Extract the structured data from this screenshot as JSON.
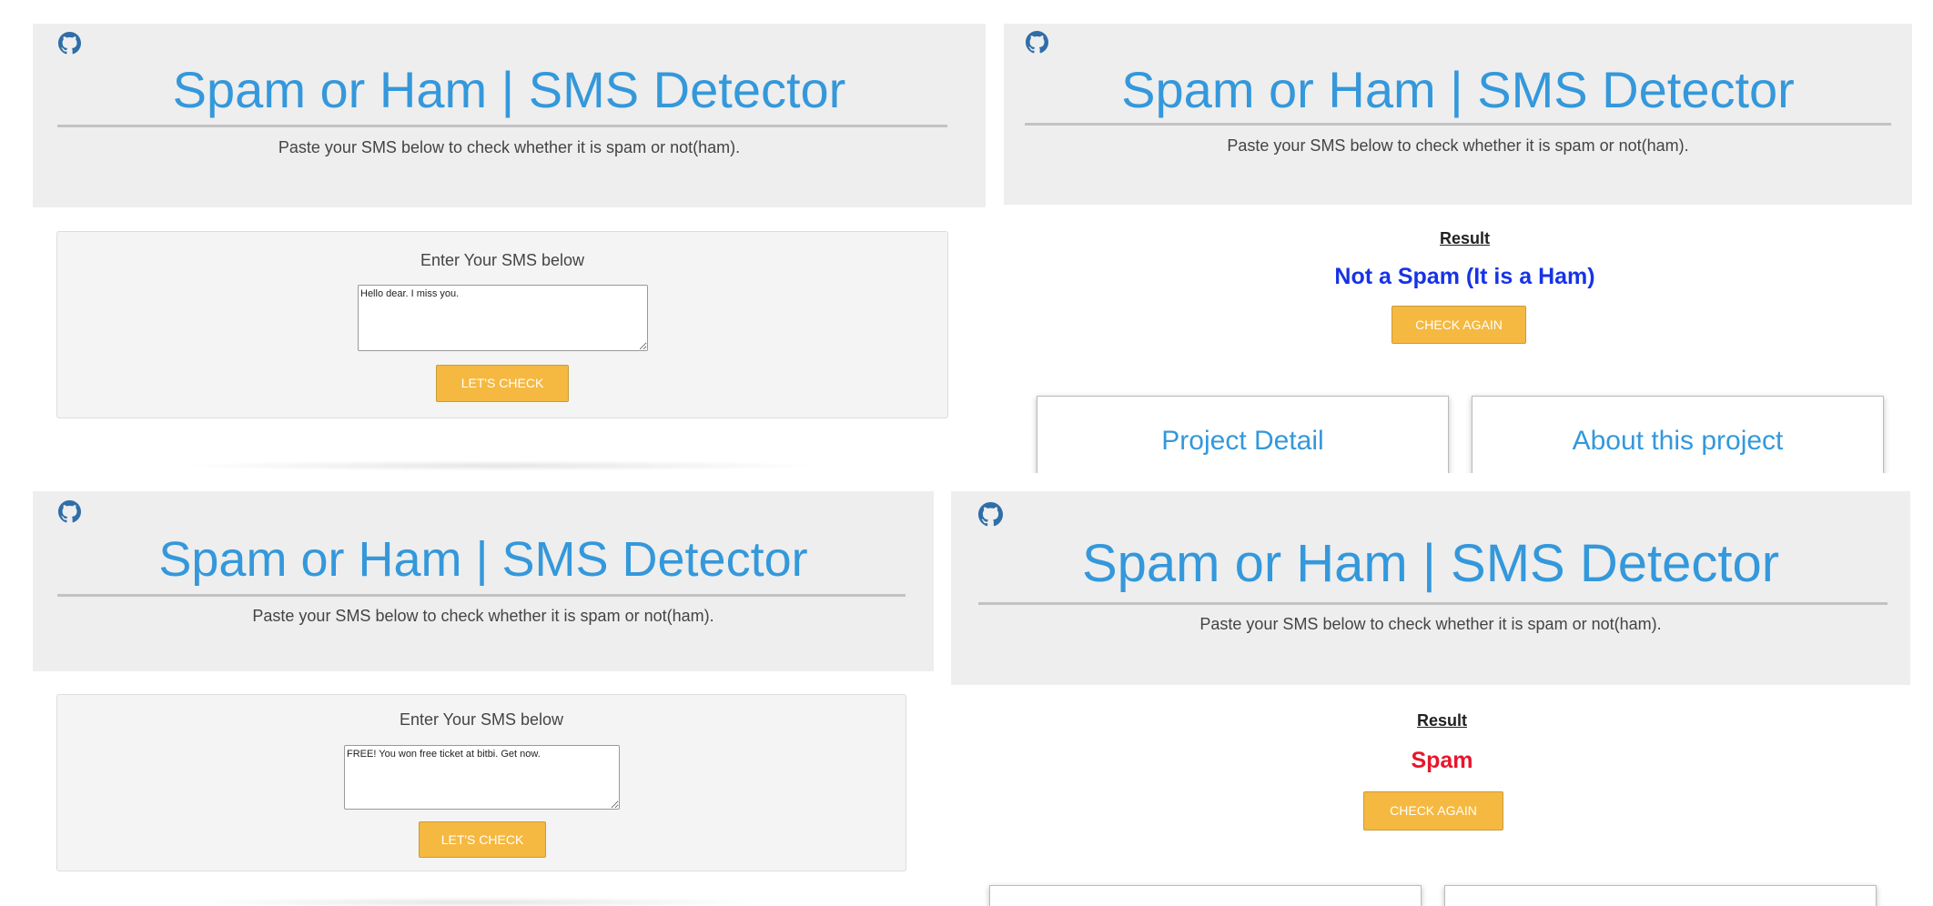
{
  "app": {
    "title": "Spam or Ham | SMS Detector",
    "subtitle": "Paste your SMS below to check whether it is spam or not(ham).",
    "icon": "github-icon"
  },
  "colors": {
    "title": "#3498db",
    "header_bg": "#eeeeee",
    "button": "#f5b941",
    "ham_result": "#1733e6",
    "spam_result": "#e6162c"
  },
  "form_views": [
    {
      "label": "Enter Your SMS below",
      "sms_value": "Hello dear. I miss you.",
      "button_label": "LET'S CHECK"
    },
    {
      "label": "Enter Your SMS below",
      "sms_value": "FREE! You won free ticket at bitbi. Get now. ",
      "button_label": "LET'S CHECK"
    }
  ],
  "result_views": [
    {
      "heading": "Result",
      "result": "Not a Spam (It is a Ham)",
      "button_label": "CHECK AGAIN",
      "cards": [
        "Project Detail",
        "About this project"
      ]
    },
    {
      "heading": "Result",
      "result": "Spam",
      "button_label": "CHECK AGAIN",
      "cards": [
        "",
        ""
      ]
    }
  ]
}
